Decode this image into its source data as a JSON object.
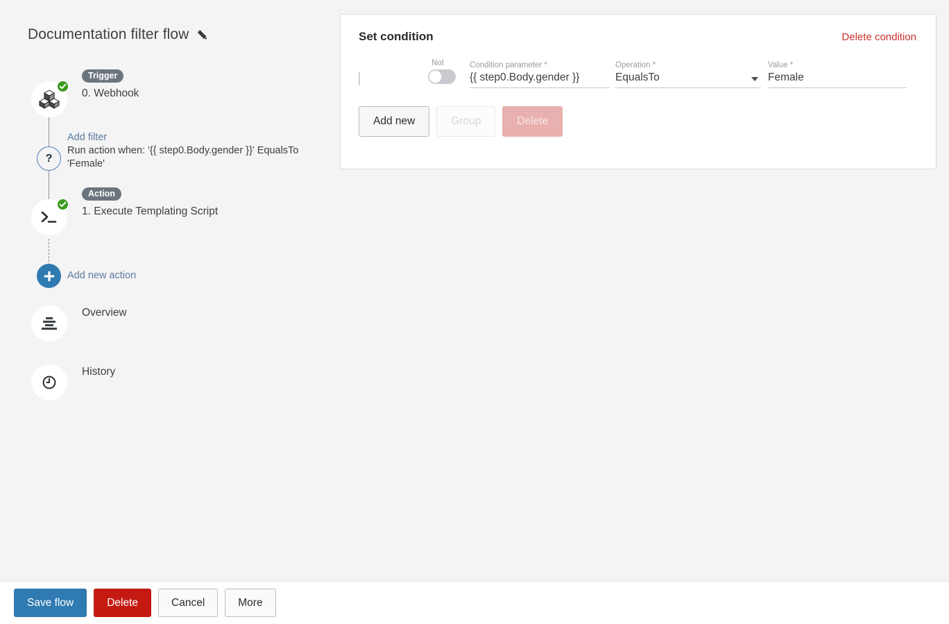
{
  "flow": {
    "title": "Documentation filter flow",
    "edit_icon": "pencil-icon"
  },
  "steps": [
    {
      "badge": "Trigger",
      "label": "0. Webhook",
      "icon": "webhook-cubes-icon",
      "status": "ok"
    },
    {
      "badge": "Action",
      "label": "1. Execute Templating Script",
      "icon": "terminal-prompt-icon",
      "status": "ok"
    }
  ],
  "filter": {
    "icon": "question-mark-icon",
    "add_link": "Add filter",
    "description": "Run action when: '{{ step0.Body.gender }}' EqualsTo 'Female'"
  },
  "add_action": {
    "icon": "plus-icon",
    "label": "Add new action"
  },
  "nav": [
    {
      "icon": "overview-bars-icon",
      "label": "Overview"
    },
    {
      "icon": "clock-history-icon",
      "label": "History"
    }
  ],
  "condition_panel": {
    "title": "Set condition",
    "delete_link": "Delete condition",
    "labels": {
      "not": "Not",
      "condition_parameter": "Condition parameter *",
      "operation": "Operation *",
      "value": "Value *"
    },
    "row": {
      "checkbox_checked": false,
      "not_toggle_on": false,
      "condition_parameter": "{{ step0.Body.gender }}",
      "condition_parameter_placeholder": "Condition parameter",
      "operation": "EqualsTo",
      "operation_options": [
        "EqualsTo"
      ],
      "value": "Female",
      "value_placeholder": "Value"
    },
    "buttons": {
      "add_new": "Add new",
      "group": "Group",
      "delete": "Delete"
    }
  },
  "bottom_bar": {
    "save": "Save flow",
    "delete": "Delete",
    "cancel": "Cancel",
    "more": "More"
  },
  "colors": {
    "primary_blue": "#2f7ab0",
    "danger_red": "#c41a12",
    "delete_link_red": "#c9302c",
    "badge_gray": "#6c757d",
    "link_blue": "#5c7b9e",
    "status_green": "#3a9b1f",
    "page_bg": "#f4f4f4"
  }
}
